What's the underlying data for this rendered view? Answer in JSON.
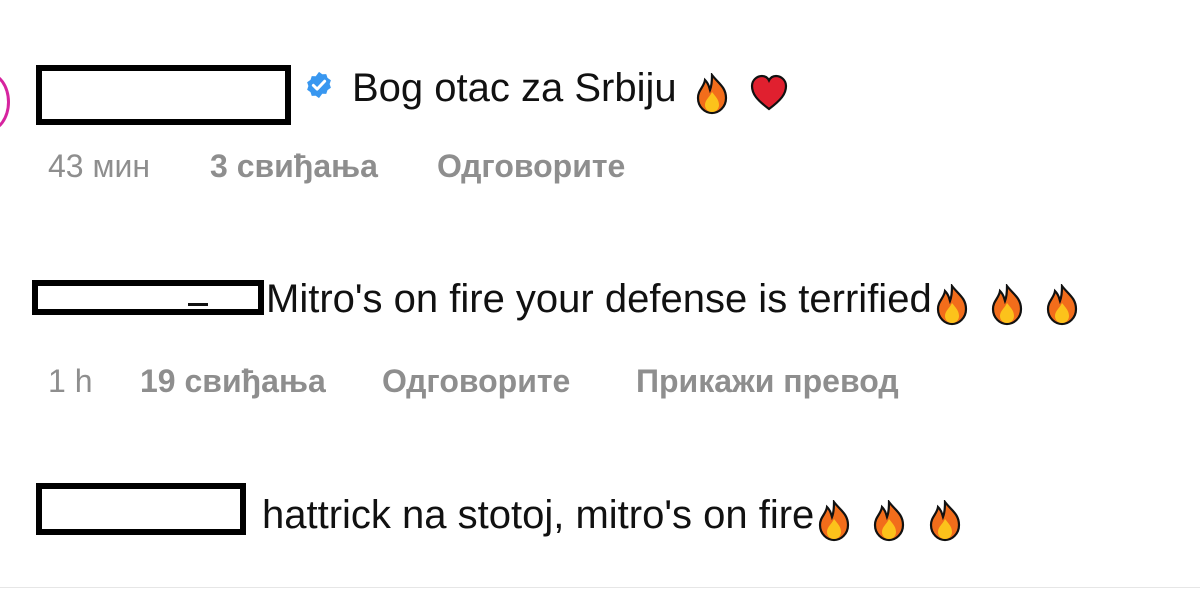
{
  "comments": [
    {
      "username_redacted": true,
      "verified": true,
      "text": "Bog otac za Srbiju",
      "emojis": [
        "fire",
        "heart"
      ],
      "time": "43 мин",
      "likes": "3 свиђања",
      "reply_label": "Одговорите"
    },
    {
      "username_redacted": true,
      "verified": false,
      "text": "Mitro's on fire your defense is terrified",
      "emojis": [
        "fire",
        "fire",
        "fire"
      ],
      "time": "1 h",
      "likes": "19 свиђања",
      "reply_label": "Одговорите",
      "translate_label": "Прикажи превод"
    },
    {
      "username_redacted": true,
      "verified": false,
      "text": "hattrick na stotoj, mitro's on fire",
      "emojis": [
        "fire",
        "fire",
        "fire"
      ]
    }
  ],
  "colors": {
    "verified_blue": "#3897f0",
    "meta_gray": "#8e8e8e",
    "story_ring": "#d6249f"
  }
}
